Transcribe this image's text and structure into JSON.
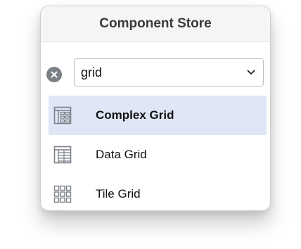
{
  "popup": {
    "title": "Component Store"
  },
  "search": {
    "value": "grid",
    "clear_icon": "clear-x-circle-icon",
    "dropdown_icon": "chevron-down-icon"
  },
  "results": [
    {
      "label": "Complex Grid",
      "icon": "complex-grid-icon",
      "selected": true
    },
    {
      "label": "Data Grid",
      "icon": "data-grid-icon",
      "selected": false
    },
    {
      "label": "Tile Grid",
      "icon": "tile-grid-icon",
      "selected": false
    }
  ],
  "colors": {
    "selection": "#dfe6f5",
    "icon_gray": "#7b7f86",
    "title_bar": "#f5f5f6"
  }
}
